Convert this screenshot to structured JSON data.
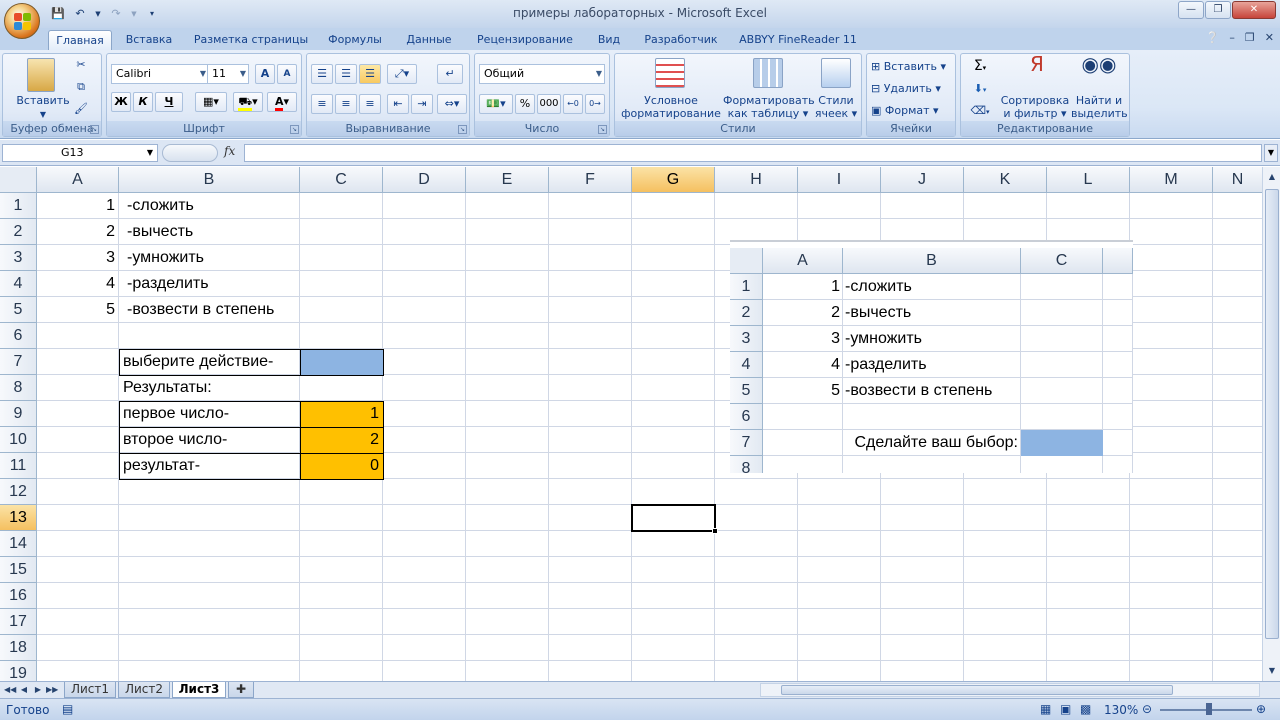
{
  "window": {
    "title": "примеры лабораторных - Microsoft Excel"
  },
  "tabs": [
    "Главная",
    "Вставка",
    "Разметка страницы",
    "Формулы",
    "Данные",
    "Рецензирование",
    "Вид",
    "Разработчик",
    "ABBYY FineReader 11"
  ],
  "ribbon": {
    "clipboard": {
      "label": "Буфер обмена",
      "paste": "Вставить"
    },
    "font": {
      "label": "Шрифт",
      "name": "Calibri",
      "size": "11",
      "bold": "Ж",
      "italic": "К",
      "underline": "Ч"
    },
    "alignment": {
      "label": "Выравнивание"
    },
    "number": {
      "label": "Число",
      "format": "Общий",
      "percent": "%",
      "thousands": "000"
    },
    "styles": {
      "label": "Стили",
      "cond_format_1": "Условное",
      "cond_format_2": "форматирование",
      "table_format_1": "Форматировать",
      "table_format_2": "как таблицу",
      "cell_styles_1": "Стили",
      "cell_styles_2": "ячеек"
    },
    "cells": {
      "label": "Ячейки",
      "insert": "Вставить",
      "delete": "Удалить",
      "format": "Формат"
    },
    "editing": {
      "label": "Редактирование",
      "sort_1": "Сортировка",
      "sort_2": "и фильтр",
      "find_1": "Найти и",
      "find_2": "выделить"
    }
  },
  "formula_bar": {
    "name_box": "G13",
    "fx": "fx",
    "formula": ""
  },
  "columns": [
    "A",
    "B",
    "C",
    "D",
    "E",
    "F",
    "G",
    "H",
    "I",
    "J",
    "K",
    "L",
    "M",
    "N"
  ],
  "rows": [
    "1",
    "2",
    "3",
    "4",
    "5",
    "6",
    "7",
    "8",
    "9",
    "10",
    "11",
    "12",
    "13",
    "14",
    "15",
    "16",
    "17",
    "18",
    "19"
  ],
  "selected": {
    "column": "G",
    "row": "13"
  },
  "cells": {
    "A1": "1",
    "B1": "-сложить",
    "A2": "2",
    "B2": "-вычесть",
    "A3": "3",
    "B3": "-умножить",
    "A4": "4",
    "B4": "-разделить",
    "A5": "5",
    "B5": "-возвести в степень",
    "B7": "выберите действие-",
    "B8": "Результаты:",
    "B9": "первое число-",
    "C9": "1",
    "B10": "второе число-",
    "C10": "2",
    "B11": "результат-",
    "C11": "0"
  },
  "embedded_image": {
    "columns": [
      "A",
      "B",
      "C"
    ],
    "rows": [
      "1",
      "2",
      "3",
      "4",
      "5",
      "6",
      "7",
      "8"
    ],
    "items": [
      {
        "num": "1",
        "label": "-сложить"
      },
      {
        "num": "2",
        "label": "-вычесть"
      },
      {
        "num": "3",
        "label": "-умножить"
      },
      {
        "num": "4",
        "label": "-разделить"
      },
      {
        "num": "5",
        "label": "-возвести в степень"
      }
    ],
    "prompt": "Сделайте ваш быбор:"
  },
  "sheets": [
    "Лист1",
    "Лист2",
    "Лист3"
  ],
  "active_sheet": "Лист3",
  "status": {
    "text": "Готово",
    "zoom": "130%"
  },
  "colors": {
    "blue_fill": "#8db4e2",
    "orange_fill": "#ffc000",
    "selection_header": "#f5c060"
  }
}
